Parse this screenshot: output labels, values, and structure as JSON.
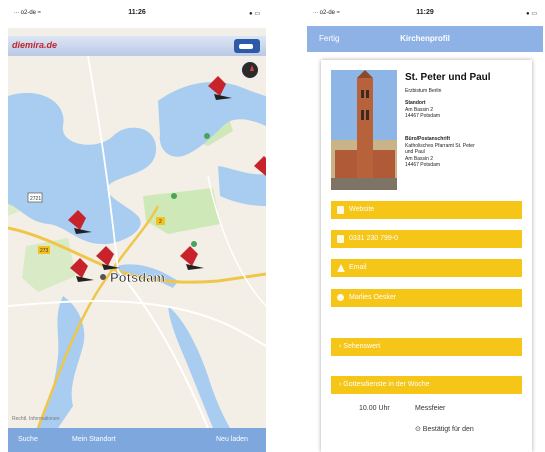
{
  "left_screen": {
    "status_bar": {
      "carrier": "∙∙∙ o2-de ≈",
      "time": "11:26",
      "battery": "● ▭"
    },
    "brand_logo": "diemira.de",
    "map": {
      "city_label": "Potsdam",
      "road_labels": [
        "2721",
        "2",
        "273"
      ]
    },
    "attribution": "Rechtl. Informationen",
    "bottom_bar": {
      "search": "Suche",
      "my_location": "Mein Standort",
      "reload": "Neu laden"
    }
  },
  "right_screen": {
    "status_bar": {
      "carrier": "∙∙∙ o2-de ≈",
      "time": "11:29",
      "battery": "● ▭"
    },
    "nav": {
      "done": "Fertig",
      "title": "Kirchenprofil"
    },
    "church": {
      "name": "St. Peter und Paul",
      "diocese": "Erzbistum Berlin",
      "location_label": "Standort",
      "location_street": "Am Bassin 2",
      "location_city": "14467 Potsdam",
      "office_label": "Büro/Postanschrift",
      "office_line1": "Katholisches Pfarramt St. Peter",
      "office_line2": "und Paul",
      "office_street": "Am Bassin 2",
      "office_city": "14467 Potsdam"
    },
    "buttons": {
      "website": "Website",
      "phone": "0331 230 799-0",
      "email": "Email",
      "contact": "Marlies Oesker",
      "sights": "› Sehenswert",
      "weekday_services": "‹ Gottesdienste in der Woche"
    },
    "mass": {
      "time": "10.00 Uhr",
      "type": "Messfeier",
      "note": "⊙ Bestätigt für den"
    }
  }
}
